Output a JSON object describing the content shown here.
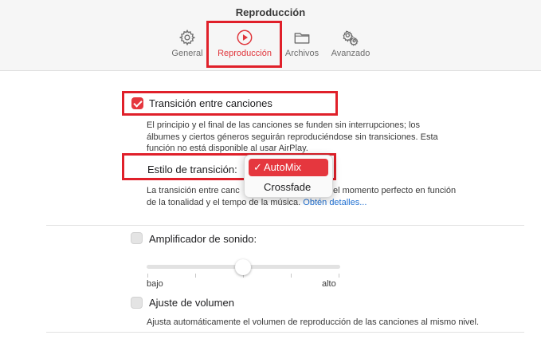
{
  "window": {
    "title": "Reproducción"
  },
  "tabs": [
    {
      "label": "General",
      "icon": "gear-icon",
      "active": false
    },
    {
      "label": "Reproducción",
      "icon": "play-circle-icon",
      "active": true
    },
    {
      "label": "Archivos",
      "icon": "folder-icon",
      "active": false
    },
    {
      "label": "Avanzado",
      "icon": "gears-icon",
      "active": false
    }
  ],
  "crossfade": {
    "checkbox_label": "Transición entre canciones",
    "checked": true,
    "description_1": "El principio y el final de las canciones se funden sin interrupciones; los",
    "description_2": "álbumes y ciertos géneros seguirán reproduciéndose sin transiciones. Esta",
    "description_3": "función no está disponible al usar AirPlay.",
    "style_label": "Estilo de transición:",
    "style_options": [
      "AutoMix",
      "Crossfade"
    ],
    "style_selected": "AutoMix",
    "style_check": "✓",
    "style_desc_1a": "La transición entre canc",
    "style_desc_1b": "el momento perfecto en función",
    "style_desc_2a": "de la tonalidad y el tempo de la música.",
    "style_desc_link": "Obtén detalles..."
  },
  "sound_enhancer": {
    "checkbox_label": "Amplificador de sonido:",
    "checked": false,
    "level": 0.5,
    "min_label": "bajo",
    "max_label": "alto"
  },
  "sound_check": {
    "checkbox_label": "Ajuste de volumen",
    "checked": false,
    "description": "Ajusta automáticamente el volumen de reproducción de las canciones al mismo nivel."
  },
  "colors": {
    "accent": "#e5373e",
    "highlight_box": "#e0202a",
    "link": "#1f6fd1"
  }
}
